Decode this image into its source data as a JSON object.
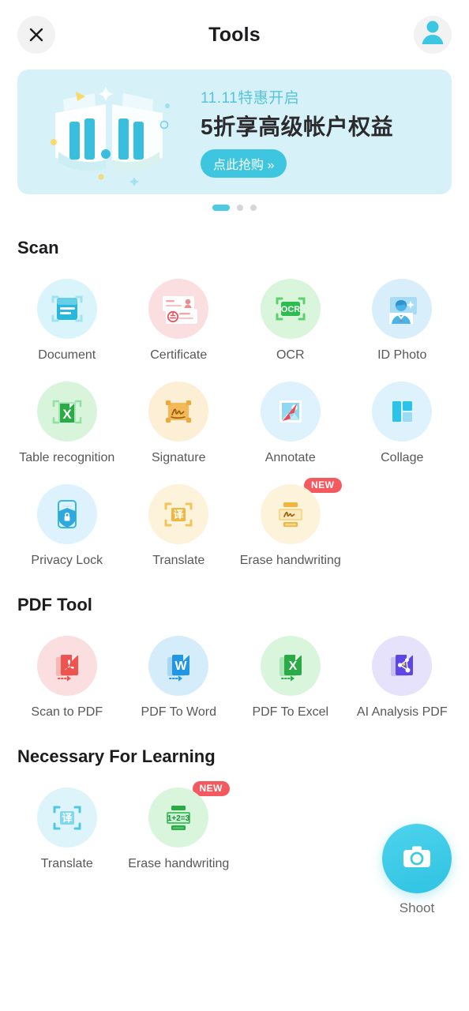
{
  "header": {
    "title": "Tools",
    "close_icon": "close-icon",
    "avatar_icon": "user-avatar-icon"
  },
  "banner": {
    "kicker": "11.11特惠开启",
    "title": "5折享高级帐户权益",
    "cta": "点此抢购 »",
    "bg_color": "#d7f1f8",
    "accent_color": "#3ec6e0",
    "art_icon": "open-book-1111-icon",
    "pagination": {
      "count": 3,
      "active_index": 0
    }
  },
  "sections": [
    {
      "title": "Scan",
      "items": [
        {
          "label": "Document",
          "icon": "document-scan-icon",
          "bg": "#daf4fb",
          "badge": ""
        },
        {
          "label": "Certificate",
          "icon": "id-card-icon",
          "bg": "#fbdfe0",
          "badge": ""
        },
        {
          "label": "OCR",
          "icon": "ocr-scan-icon",
          "bg": "#d9f6dd",
          "badge": ""
        },
        {
          "label": "ID Photo",
          "icon": "id-photo-icon",
          "bg": "#d9eefb",
          "badge": ""
        },
        {
          "label": "Table recognition",
          "icon": "excel-table-scan-icon",
          "bg": "#d8f5dc",
          "badge": ""
        },
        {
          "label": "Signature",
          "icon": "signature-icon",
          "bg": "#fdeed6",
          "badge": ""
        },
        {
          "label": "Annotate",
          "icon": "annotate-arrow-icon",
          "bg": "#ddf2fc",
          "badge": ""
        },
        {
          "label": "Collage",
          "icon": "collage-grid-icon",
          "bg": "#ddf2fc",
          "badge": ""
        },
        {
          "label": "Privacy Lock",
          "icon": "privacy-lock-icon",
          "bg": "#ddf2fc",
          "badge": ""
        },
        {
          "label": "Translate",
          "icon": "translate-scan-icon",
          "bg": "#fdf2da",
          "badge": ""
        },
        {
          "label": "Erase handwriting",
          "icon": "erase-handwriting-icon",
          "bg": "#fdf3db",
          "badge": "NEW"
        }
      ]
    },
    {
      "title": "PDF Tool",
      "items": [
        {
          "label": "Scan to PDF",
          "icon": "pdf-file-icon",
          "bg": "#fbdfe0",
          "badge": ""
        },
        {
          "label": "PDF To Word",
          "icon": "word-file-icon",
          "bg": "#d5ecfb",
          "badge": ""
        },
        {
          "label": "PDF To Excel",
          "icon": "excel-file-icon",
          "bg": "#d9f6dd",
          "badge": ""
        },
        {
          "label": "AI Analysis PDF",
          "icon": "ai-analysis-pdf-icon",
          "bg": "#e6e2fb",
          "badge": ""
        }
      ]
    },
    {
      "title": "Necessary For Learning",
      "items": [
        {
          "label": "Translate",
          "icon": "translate-scan-blue-icon",
          "bg": "#ddf4fb",
          "badge": ""
        },
        {
          "label": "Erase handwriting",
          "icon": "erase-math-green-icon",
          "bg": "#d9f6dd",
          "badge": "NEW"
        }
      ]
    }
  ],
  "shoot": {
    "label": "Shoot",
    "icon": "camera-icon",
    "color": "#35c7e6"
  }
}
